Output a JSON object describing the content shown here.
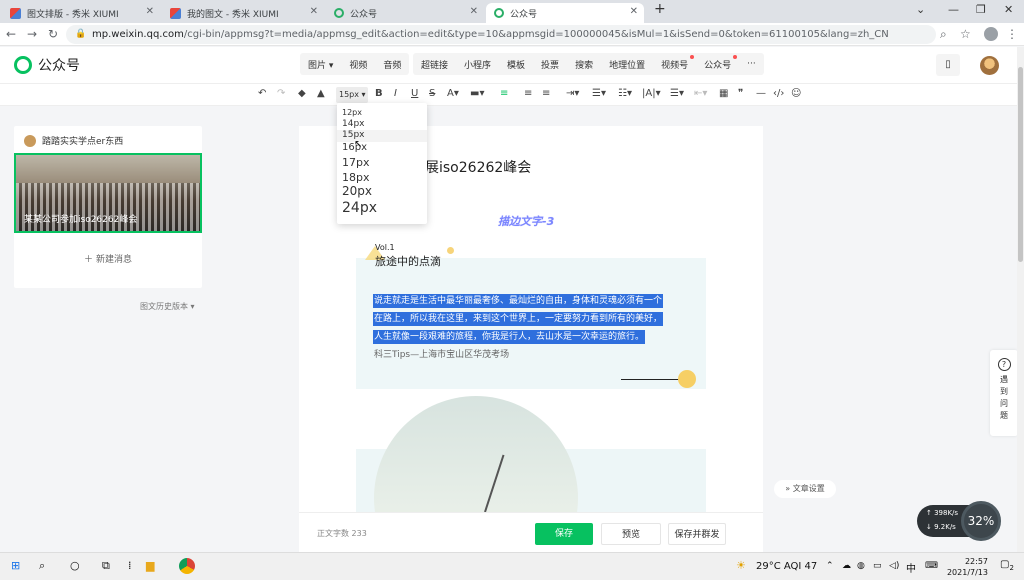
{
  "tabs": [
    {
      "label": "图文排版 - 秀米 XIUMI",
      "icon": "xiumi-icon"
    },
    {
      "label": "我的图文 - 秀米 XIUMI",
      "icon": "xiumi-icon"
    },
    {
      "label": "公众号",
      "icon": "wechat-icon"
    },
    {
      "label": "公众号",
      "icon": "wechat-icon",
      "active": true
    }
  ],
  "address": {
    "host": "mp.weixin.qq.com",
    "path": "/cgi-bin/appmsg?t=media/appmsg_edit&action=edit&type=10&appmsgid=100000045&isMul=1&isSend=0&token=61100105&lang=zh_CN"
  },
  "app": {
    "logo_text": "公众号"
  },
  "insert_menu": {
    "media": [
      "图片",
      "视频",
      "音频"
    ],
    "tools": [
      "超链接",
      "小程序",
      "模板",
      "投票",
      "搜索",
      "地理位置",
      "视频号",
      "公众号",
      "···"
    ]
  },
  "format_toolbar": {
    "font_size": "15px"
  },
  "font_size_dropdown": {
    "options": [
      "12px",
      "14px",
      "15px",
      "16px",
      "17px",
      "18px",
      "20px",
      "24px"
    ],
    "highlighted": "15px"
  },
  "left_panel": {
    "account_name": "踏踏实实学点er东西",
    "thumbnail_caption": "某某公司参加iso26262峰会",
    "new_message": "新建消息",
    "history": "图文历史版本"
  },
  "editor": {
    "title": "展iso26262峰会",
    "subtitle": "描边文字-3",
    "vol": "Vol.1",
    "section_title": "旅途中的点滴",
    "selected_lines": [
      "说走就走是生活中最华丽最奢侈、最灿烂的自由，身体和灵魂必须有一个",
      "在路上，所以我在这里，来到这个世界上，一定要努力看到所有的美好，",
      "人生就像一段艰难的旅程，你我是行人，去山水是一次幸运的旅行。"
    ],
    "tips": "科三Tips—上海市宝山区华茂考场"
  },
  "bottom_bar": {
    "word_count": "正文字数 233",
    "save": "保存",
    "preview": "预览",
    "save_and_send": "保存并群发"
  },
  "help": {
    "text": "遇到问题"
  },
  "article_settings": "文章设置",
  "net_widget": {
    "up": "398K/s",
    "down": "9.2K/s",
    "percent": "32%"
  },
  "taskbar": {
    "weather": "29°C AQI 47",
    "ime": "中",
    "time": "22:57",
    "date": "2021/7/13",
    "notifications": "2"
  },
  "colors": {
    "brand_green": "#07c160",
    "selection_blue": "#2f6fdd",
    "subtitle_purple": "#7b86ff"
  }
}
